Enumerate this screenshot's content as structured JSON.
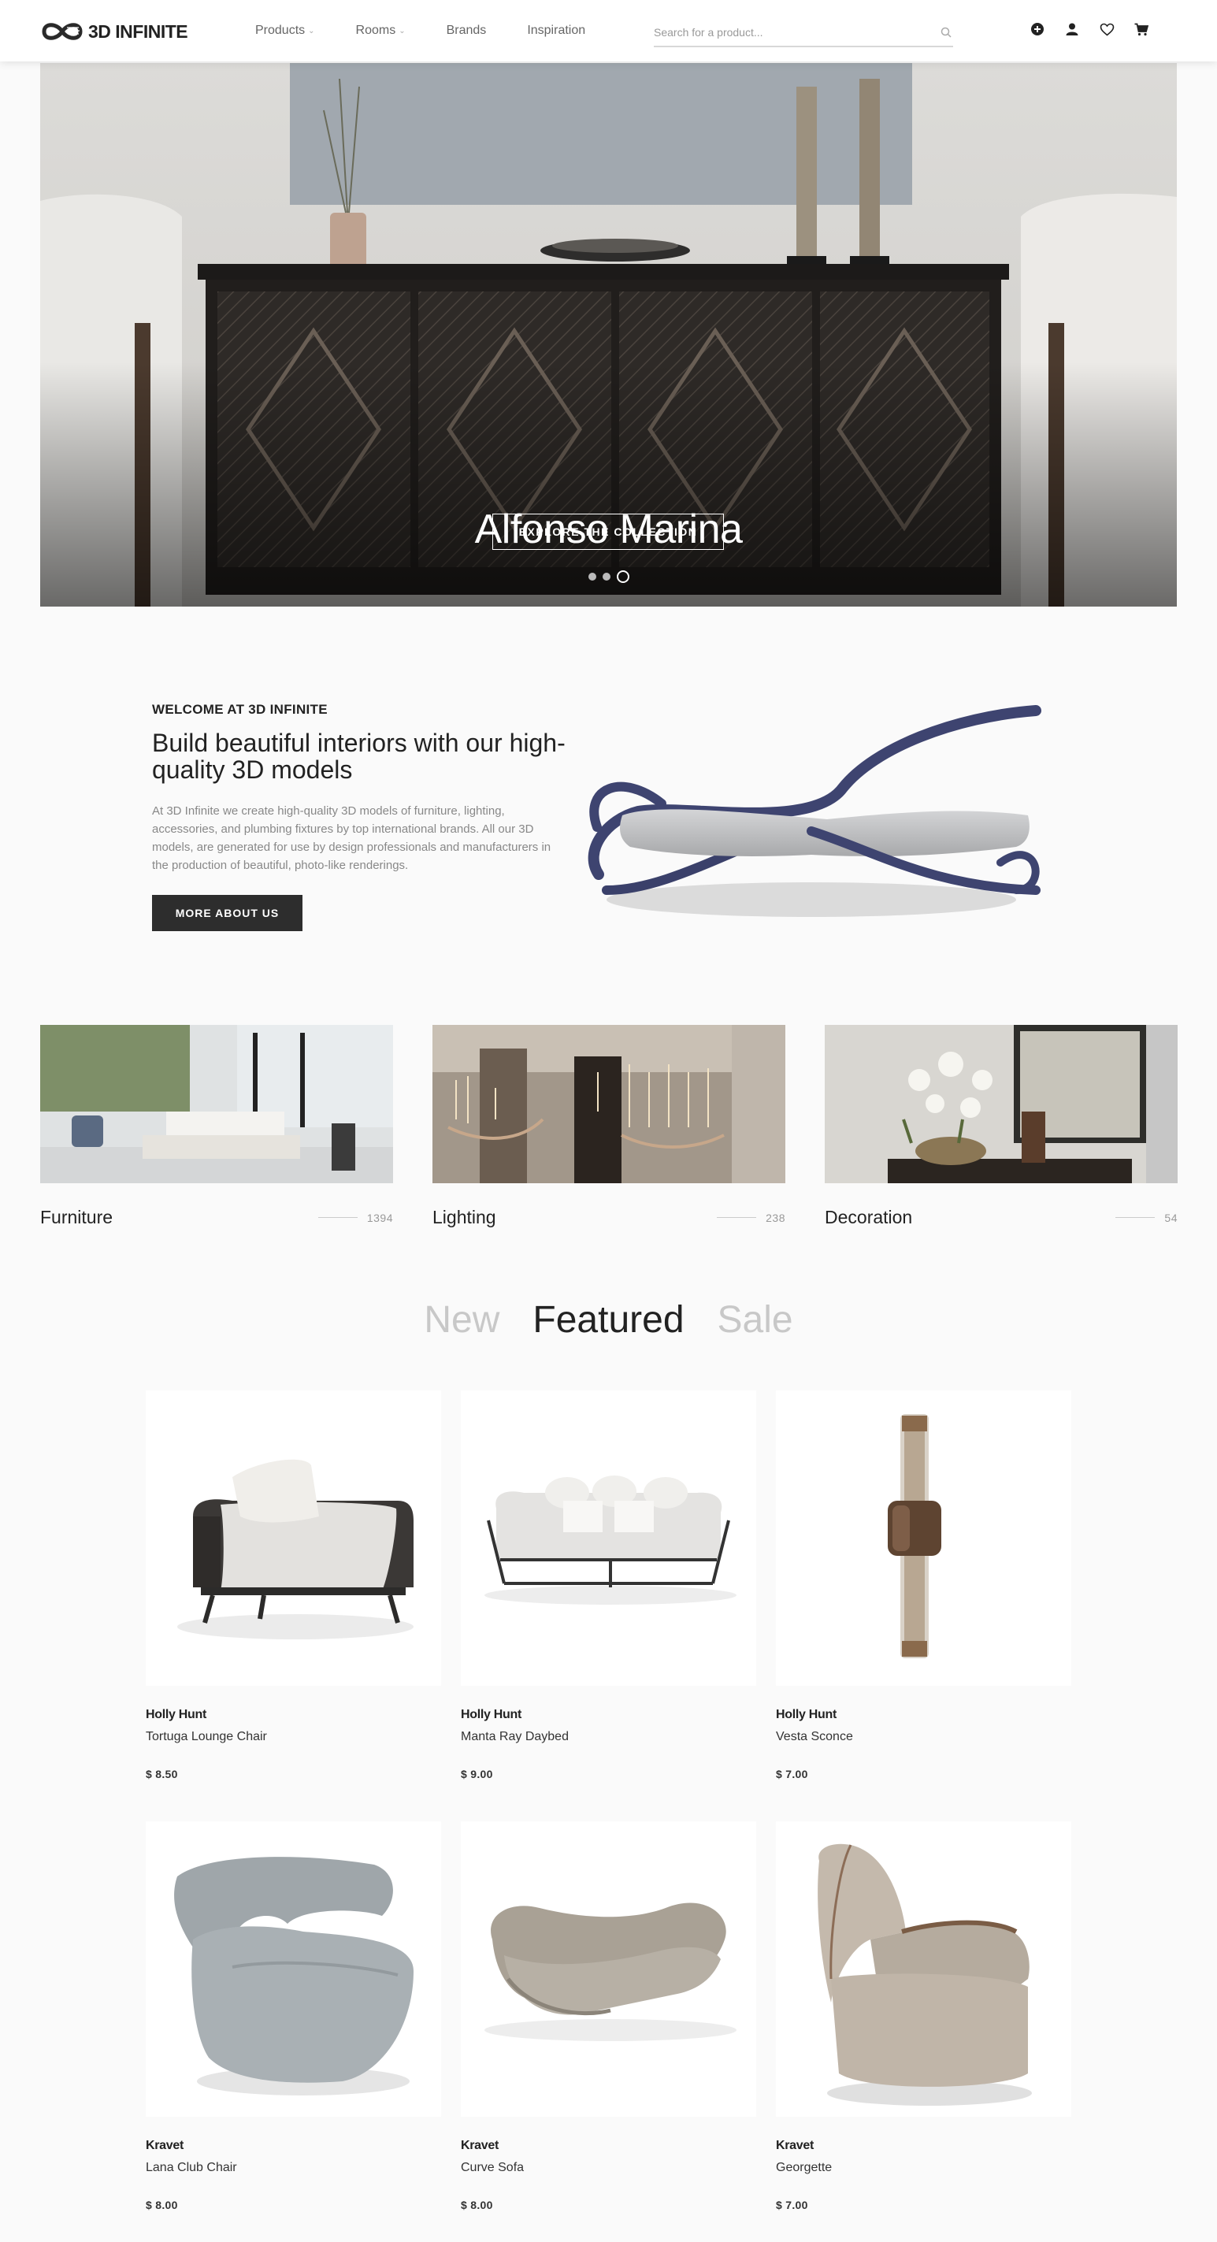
{
  "header": {
    "logo_text": "3D INFINITE",
    "nav": [
      {
        "label": "Products",
        "has_dropdown": true
      },
      {
        "label": "Rooms",
        "has_dropdown": true
      },
      {
        "label": "Brands",
        "has_dropdown": false
      },
      {
        "label": "Inspiration",
        "has_dropdown": false
      }
    ],
    "search": {
      "placeholder": "Search for a product...",
      "value": ""
    },
    "icons": [
      "add-circle-icon",
      "user-icon",
      "heart-icon",
      "cart-icon"
    ]
  },
  "hero": {
    "title": "Alfonso Marina",
    "button_label": "EXPLORE THE COLLECTION",
    "slides_count": 3,
    "active_slide": 3
  },
  "about": {
    "eyebrow": "WELCOME AT 3D INFINITE",
    "heading": "Build beautiful interiors with our high-quality 3D models",
    "body": "At 3D Infinite we create high-quality 3D models of furniture, lighting, accessories, and plumbing fixtures by top international brands. All our 3D models, are generated for use by design professionals and manufacturers in the production of beautiful, photo-like renderings.",
    "button_label": "MORE ABOUT US"
  },
  "categories": [
    {
      "name": "Furniture",
      "count": "1394"
    },
    {
      "name": "Lighting",
      "count": "238"
    },
    {
      "name": "Decoration",
      "count": "54"
    }
  ],
  "tabs": [
    {
      "label": "New",
      "active": false
    },
    {
      "label": "Featured",
      "active": true
    },
    {
      "label": "Sale",
      "active": false
    }
  ],
  "products": [
    {
      "brand": "Holly Hunt",
      "name": "Tortuga Lounge Chair",
      "price": "$ 8.50"
    },
    {
      "brand": "Holly Hunt",
      "name": "Manta Ray Daybed",
      "price": "$ 9.00"
    },
    {
      "brand": "Holly Hunt",
      "name": "Vesta Sconce",
      "price": "$ 7.00"
    },
    {
      "brand": "Kravet",
      "name": "Lana Club Chair",
      "price": "$ 8.00"
    },
    {
      "brand": "Kravet",
      "name": "Curve Sofa",
      "price": "$ 8.00"
    },
    {
      "brand": "Kravet",
      "name": "Georgette",
      "price": "$ 7.00"
    }
  ],
  "colors": {
    "text_dark": "#222222",
    "text_muted": "#888888",
    "button_dark": "#2d2d2d",
    "tab_inactive": "#c8c8c8",
    "page_background": "#fafafa"
  }
}
